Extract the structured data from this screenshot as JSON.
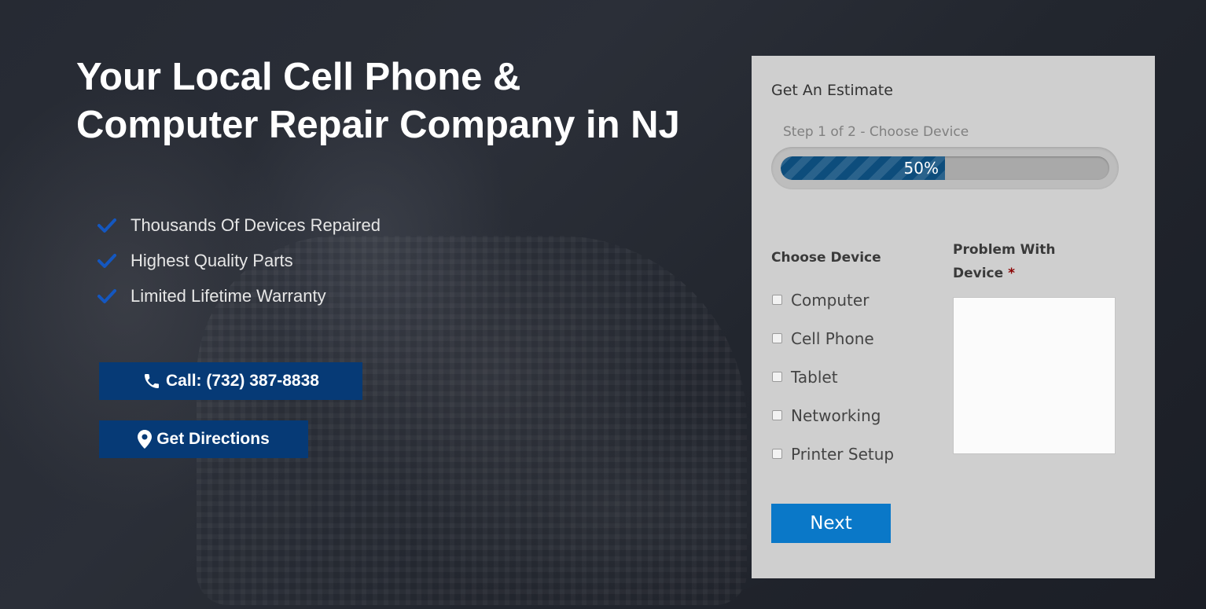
{
  "hero": {
    "headline_line1": "Your Local Cell Phone &",
    "headline_line2": "Computer Repair Company in NJ",
    "features": [
      {
        "label": "Thousands Of Devices Repaired",
        "icon": "check-icon"
      },
      {
        "label": "Highest Quality Parts",
        "icon": "check-icon"
      },
      {
        "label": "Limited Lifetime Warranty",
        "icon": "check-icon"
      }
    ],
    "call_button": {
      "label": "Call: (732) 387-8838",
      "icon": "phone-icon"
    },
    "directions_button": {
      "label": "Get Directions",
      "icon": "map-marker-icon"
    }
  },
  "estimate_form": {
    "title": "Get An Estimate",
    "step_label": "Step 1 of 2 - Choose Device",
    "progress": {
      "percent": 50,
      "label": "50%"
    },
    "choose_device_label": "Choose Device",
    "device_options": [
      {
        "label": "Computer",
        "checked": false
      },
      {
        "label": "Cell Phone",
        "checked": false
      },
      {
        "label": "Tablet",
        "checked": false
      },
      {
        "label": "Networking",
        "checked": false
      },
      {
        "label": "Printer Setup",
        "checked": false
      }
    ],
    "problem_label": "Problem With Device",
    "required_marker": "*",
    "problem_value": "",
    "next_button": "Next"
  },
  "colors": {
    "accent_blue": "#0a78c8",
    "button_navy": "#063a76",
    "check_blue": "#1457c0",
    "progress_fill": "#0d4d7c",
    "panel_bg": "#cfcfcf"
  }
}
